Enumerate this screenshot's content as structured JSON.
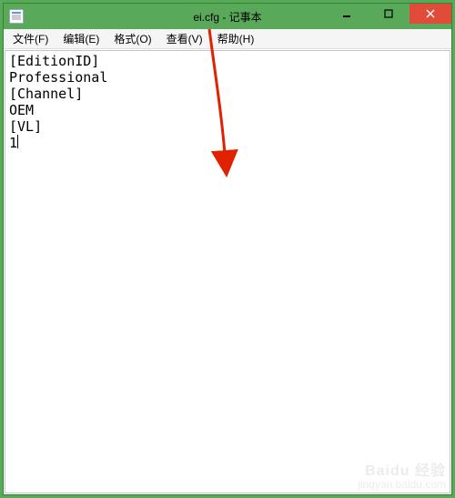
{
  "titlebar": {
    "title": "ei.cfg - 记事本"
  },
  "menubar": {
    "items": [
      {
        "label": "文件(F)"
      },
      {
        "label": "编辑(E)"
      },
      {
        "label": "格式(O)"
      },
      {
        "label": "查看(V)"
      },
      {
        "label": "帮助(H)"
      }
    ]
  },
  "editor": {
    "lines": [
      "[EditionID]",
      "Professional",
      "[Channel]",
      "OEM",
      "[VL]",
      "1"
    ]
  },
  "watermark": {
    "logo": "Baidu 经验",
    "url": "jingyan.baidu.com"
  }
}
